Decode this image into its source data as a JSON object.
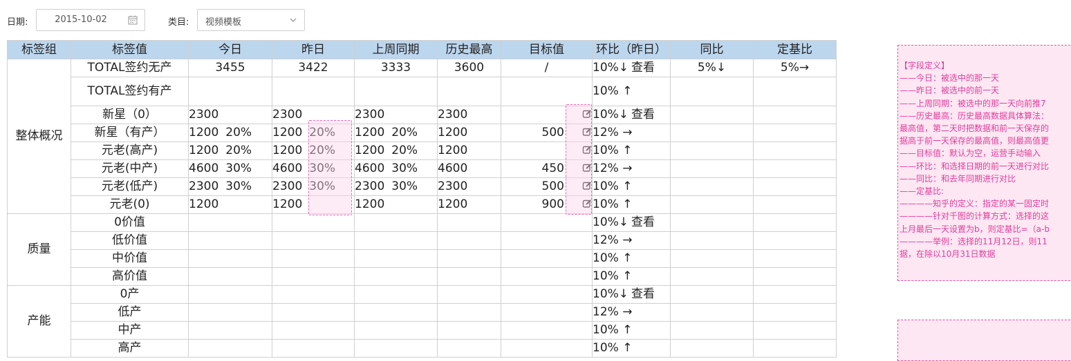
{
  "filters": {
    "date_label": "日期:",
    "date_value": "2015-10-02",
    "category_label": "类目:",
    "category_value": "视频模板"
  },
  "table": {
    "headers": [
      "标签组",
      "标签值",
      "今日",
      "昨日",
      "上周同期",
      "历史最高",
      "目标值",
      "环比（昨日）",
      "同比",
      "定基比"
    ],
    "groups": {
      "overall": "整体概况",
      "quality": "质量",
      "capacity": "产能"
    },
    "view_label": "查看",
    "rows": [
      {
        "label": "TOTAL签约无产",
        "today": "3455",
        "yesterday": "3422",
        "lastweek": "3333",
        "hist": "3600",
        "target": "/",
        "mom": "10%↓",
        "yoy": "5%↓",
        "fixed": "5%→"
      },
      {
        "label": "TOTAL签约有产",
        "mom": "10% ↑"
      },
      {
        "label": "新星（0）",
        "today": "2300",
        "yesterday": "2300",
        "lastweek": "2300",
        "hist": "2300",
        "mom": "10%↓"
      },
      {
        "label": "新星（有产）",
        "today": "1200",
        "today_pct": "20%",
        "yesterday": "1200",
        "yesterday_pct": "20%",
        "lastweek": "1200",
        "lastweek_pct": "20%",
        "hist": "1200",
        "target": "500",
        "mom": "12% →"
      },
      {
        "label": "元老(高产)",
        "today": "1200",
        "today_pct": "20%",
        "yesterday": "1200",
        "yesterday_pct": "20%",
        "lastweek": "1200",
        "lastweek_pct": "20%",
        "hist": "1200",
        "mom": "10% ↑"
      },
      {
        "label": "元老(中产)",
        "today": "4600",
        "today_pct": "30%",
        "yesterday": "4600",
        "yesterday_pct": "30%",
        "lastweek": "4600",
        "lastweek_pct": "30%",
        "hist": "4600",
        "target": "450",
        "mom": "12% →"
      },
      {
        "label": "元老(低产)",
        "today": "2300",
        "today_pct": "30%",
        "yesterday": "2300",
        "yesterday_pct": "30%",
        "lastweek": "2300",
        "lastweek_pct": "30%",
        "hist": "2300",
        "target": "500",
        "mom": "10% ↑"
      },
      {
        "label": "元老(0)",
        "today": "1200",
        "yesterday": "1200",
        "lastweek": "1200",
        "hist": "1200",
        "target": "900",
        "mom": "10% ↑"
      },
      {
        "label": "0价值",
        "mom": "10%↓"
      },
      {
        "label": "低价值",
        "mom": "12% →"
      },
      {
        "label": "中价值",
        "mom": "10% ↑"
      },
      {
        "label": "高价值",
        "mom": "10% ↑"
      },
      {
        "label": "0产",
        "mom": "10%↓"
      },
      {
        "label": "低产",
        "mom": "12% →"
      },
      {
        "label": "中产",
        "mom": "10% ↑"
      },
      {
        "label": "高产",
        "mom": "10% ↑"
      }
    ]
  },
  "note": {
    "lines": [
      "【字段定义】",
      "——今日：被选中的那一天",
      "——昨日：被选中的前一天",
      "——上周同期：被选中的那一天向前推7",
      "——历史最高：历史最高数据具体算法：",
      "最高值，第二天时把数据和前一天保存的",
      "据高于前一天保存的最高值，则最高值更",
      "——目标值：默认为空，运营手动输入",
      "——环比：和选择日期的前一天进行对比",
      "——同比：和去年同期进行对比",
      "——定基比:",
      "————知乎的定义：指定的某一固定时",
      "————针对千图的计算方式：选择的这",
      "上月最后一天设置为b，则定基比=（a-b",
      "————举例：选择的11月12日，则11",
      "据，在除以10月31日数据"
    ]
  },
  "colors": {
    "header_bg": "#bcd6ee",
    "note_text": "#e03d9c",
    "note_bg": "#fde7f3",
    "highlight_border": "#e56fb5"
  }
}
